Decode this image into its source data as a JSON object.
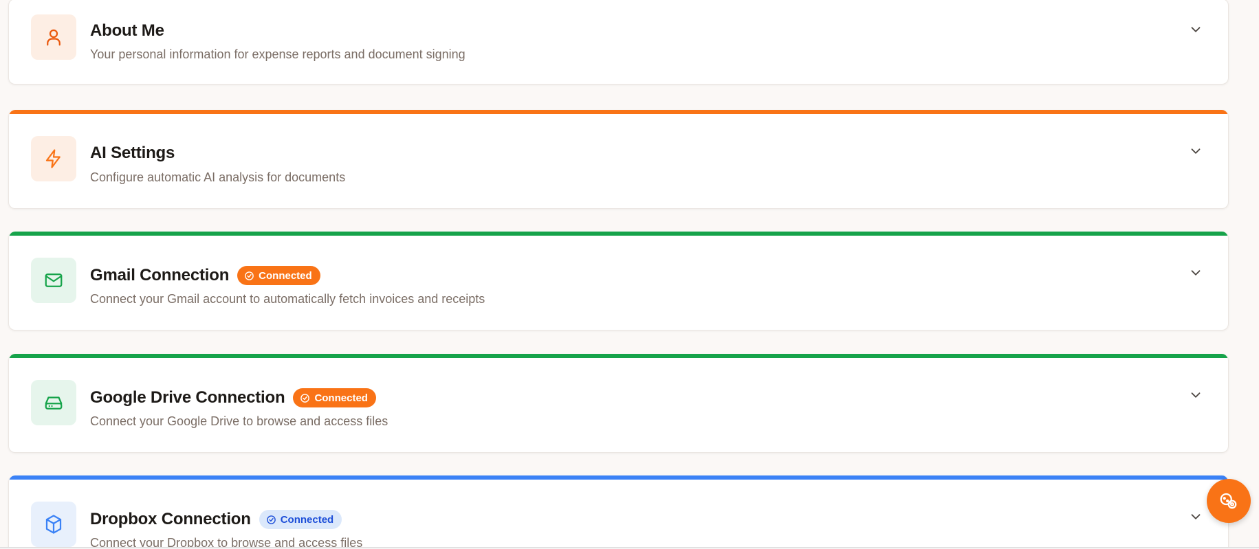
{
  "cards": [
    {
      "title": "About Me",
      "subtitle": "Your personal information for expense reports and document signing",
      "icon": "user-icon"
    },
    {
      "title": "AI Settings",
      "subtitle": "Configure automatic AI analysis for documents",
      "icon": "lightning-icon",
      "accent_color": "#f97316"
    },
    {
      "title": "Gmail Connection",
      "subtitle": "Connect your Gmail account to automatically fetch invoices and receipts",
      "badge": "Connected",
      "icon": "mail-icon",
      "accent_color": "#16a34a"
    },
    {
      "title": "Google Drive Connection",
      "subtitle": "Connect your Google Drive to browse and access files",
      "badge": "Connected",
      "icon": "hard-drive-icon",
      "accent_color": "#16a34a"
    },
    {
      "title": "Dropbox Connection",
      "subtitle": "Connect your Dropbox to browse and access files",
      "badge": "Connected",
      "icon": "box-icon",
      "accent_color": "#3b82f6"
    }
  ],
  "colors": {
    "orange": "#f97316",
    "green": "#16a34a",
    "blue": "#3b82f6",
    "page_bg": "#fbf8f6"
  },
  "fab": {
    "icon": "cookie-settings-icon"
  }
}
